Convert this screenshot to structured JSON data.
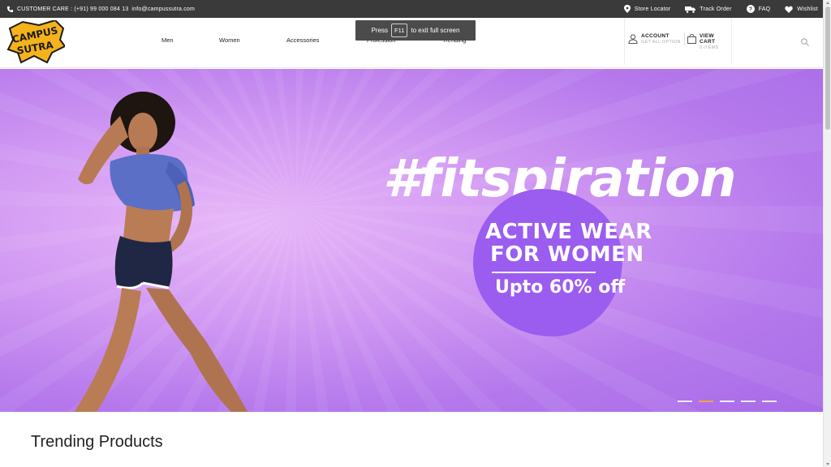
{
  "topbar": {
    "customer_care": "CUSTOMER CARE : (+91) 99 000 084 13",
    "email": "info@campussutra.com",
    "links": [
      {
        "label": "Store Locator",
        "icon": "map-pin-icon"
      },
      {
        "label": "Track Order",
        "icon": "truck-icon"
      },
      {
        "label": "FAQ",
        "icon": "question-circle-icon"
      },
      {
        "label": "Wishlist",
        "icon": "heart-icon"
      }
    ]
  },
  "header": {
    "nav": [
      "Men",
      "Women",
      "Accessories",
      "Profession",
      "Trending"
    ],
    "fullscreen_notice": {
      "press": "Press",
      "key": "F11",
      "rest": "to exit full screen"
    },
    "account": {
      "title": "ACCOUNT",
      "subtitle": "GET ALL OPTION"
    },
    "cart": {
      "title": "VIEW CART",
      "subtitle": "0 ITEMS"
    }
  },
  "hero": {
    "headline": "#fitspiration",
    "badge_line1": "ACTIVE WEAR",
    "badge_line2": "FOR WOMEN",
    "badge_line3": "Upto 60% off",
    "slide_count": 5,
    "active_slide": 2
  },
  "section": {
    "title": "Trending Products"
  },
  "colors": {
    "topbar_bg": "#3a3a3a",
    "hero_purple": "#b579ec",
    "badge_purple": "#9b5cf0",
    "dot_active": "#f2a24b"
  }
}
